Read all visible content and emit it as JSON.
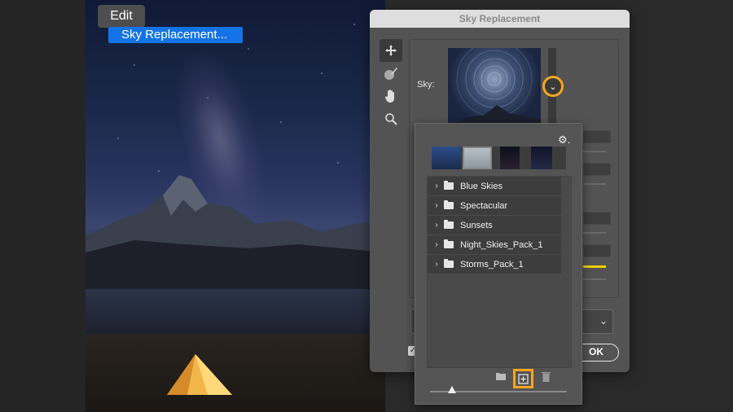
{
  "menu": {
    "edit_label": "Edit",
    "item_label": "Sky Replacement..."
  },
  "dialog": {
    "title": "Sky Replacement",
    "sky_label": "Sky:",
    "ok_label": "OK",
    "tools": [
      "move-icon",
      "sky-brush-icon",
      "hand-icon",
      "zoom-icon"
    ]
  },
  "sky_picker": {
    "folders": [
      {
        "label": "Blue Skies"
      },
      {
        "label": "Spectacular"
      },
      {
        "label": "Sunsets"
      },
      {
        "label": "Night_Skies_Pack_1"
      },
      {
        "label": "Storms_Pack_1"
      }
    ]
  },
  "colors": {
    "highlight": "#f5a623",
    "menu_selection": "#1473e6",
    "slider_yellow": "#f0d000"
  }
}
